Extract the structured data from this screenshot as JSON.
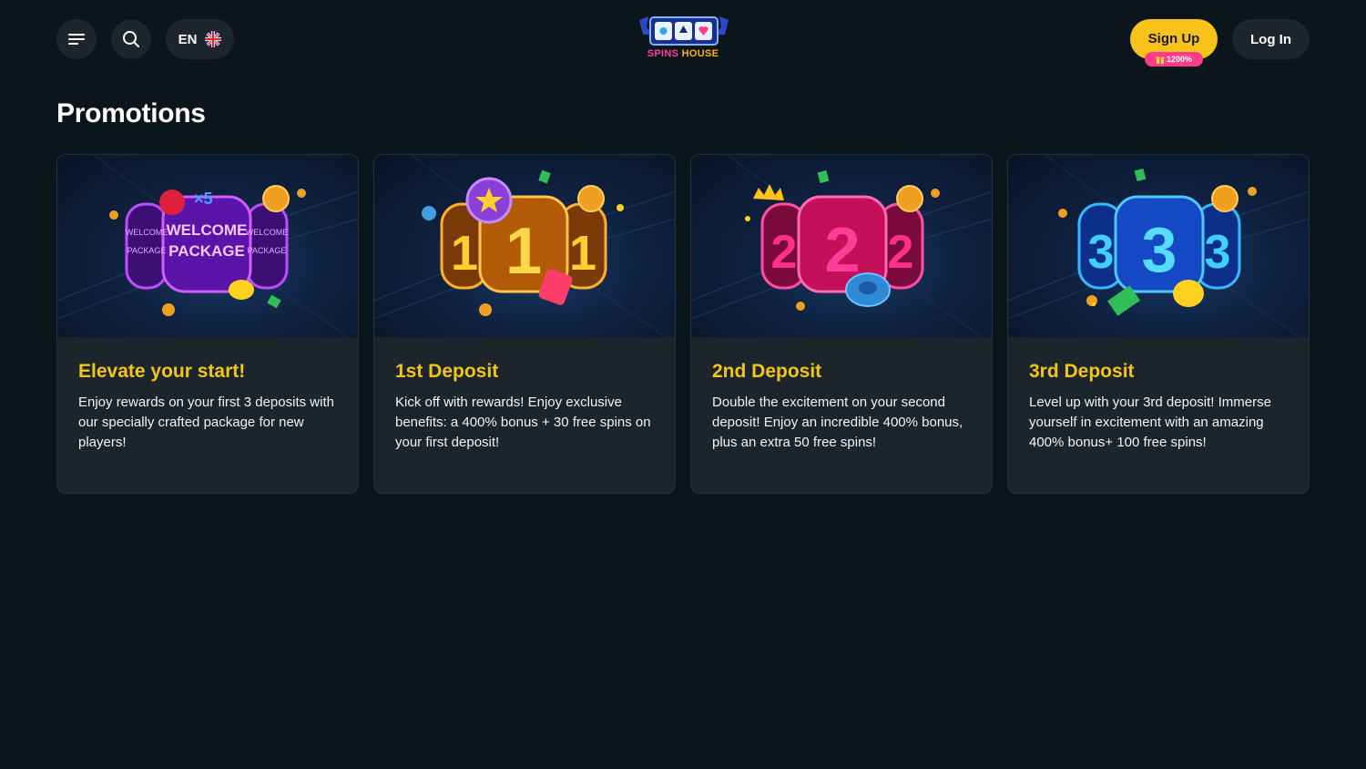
{
  "header": {
    "language": "EN",
    "logo_text": {
      "left": "SPINS",
      "right": "HOUSE"
    },
    "signup_label": "Sign Up",
    "signup_badge": "1200%",
    "login_label": "Log In"
  },
  "page": {
    "title": "Promotions"
  },
  "promotions": [
    {
      "title": "Elevate your start!",
      "description": "Enjoy rewards on your first 3 deposits with our specially crafted package for new players!",
      "art": {
        "reel_color": "#7a1fd6",
        "texts": [
          "WELCOME",
          "PACKAGE"
        ]
      }
    },
    {
      "title": "1st Deposit",
      "description": "Kick off with rewards! Enjoy exclusive benefits: a 400% bonus + 30 free spins on your first deposit!",
      "art": {
        "reel_color": "#c0620e",
        "digit": "1"
      }
    },
    {
      "title": "2nd Deposit",
      "description": "Double the excitement on your second deposit! Enjoy an incredible 400% bonus, plus an extra 50 free spins!",
      "art": {
        "reel_color": "#e0156a",
        "digit": "2"
      }
    },
    {
      "title": "3rd Deposit",
      "description": "Level up with your 3rd deposit! Immerse yourself in excitement with an amazing 400% bonus+ 100 free spins!",
      "art": {
        "reel_color": "#1556d6",
        "digit": "3"
      }
    }
  ],
  "colors": {
    "background": "#0b161c",
    "card": "#1c252b",
    "accent_yellow": "#f5c419",
    "badge_pink": "#ff3d8b"
  }
}
